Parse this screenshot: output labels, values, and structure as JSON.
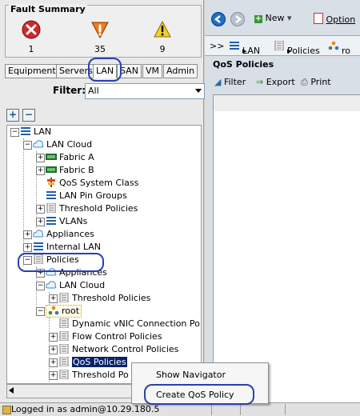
{
  "fault_summary": {
    "title": "Fault Summary",
    "counts": {
      "critical": "1",
      "major": "35",
      "minor": "9"
    }
  },
  "nav_tabs": [
    "Equipment",
    "Servers",
    "LAN",
    "SAN",
    "VM",
    "Admin"
  ],
  "filter": {
    "label": "Filter:",
    "value": "All"
  },
  "tree": {
    "items": [
      {
        "label": "LAN",
        "level": 0
      },
      {
        "label": "LAN Cloud",
        "level": 1
      },
      {
        "label": "Fabric A",
        "level": 2
      },
      {
        "label": "Fabric B",
        "level": 2
      },
      {
        "label": "QoS System Class",
        "level": 2
      },
      {
        "label": "LAN Pin Groups",
        "level": 2
      },
      {
        "label": "Threshold Policies",
        "level": 2
      },
      {
        "label": "VLANs",
        "level": 2
      },
      {
        "label": "Appliances",
        "level": 1
      },
      {
        "label": "Internal LAN",
        "level": 1
      },
      {
        "label": "Policies",
        "level": 1
      },
      {
        "label": "Appliances",
        "level": 2
      },
      {
        "label": "LAN Cloud",
        "level": 2
      },
      {
        "label": "Threshold Policies",
        "level": 3
      },
      {
        "label": "root",
        "level": 2
      },
      {
        "label": "Dynamic vNIC Connection Po",
        "level": 3
      },
      {
        "label": "Flow Control Policies",
        "level": 3
      },
      {
        "label": "Network Control Policies",
        "level": 3
      },
      {
        "label": "QoS Policies",
        "level": 3
      },
      {
        "label": "Threshold Po",
        "level": 3
      }
    ]
  },
  "status_bar": {
    "text": "Logged in as admin@10.29.180.5"
  },
  "toolbar": {
    "new_label": "New",
    "options_label": "Option"
  },
  "breadcrumb": {
    "prefix": ">>",
    "items": [
      "LAN",
      "Policies",
      "ro"
    ]
  },
  "qos_panel": {
    "title": "QoS Policies",
    "filter_label": "Filter",
    "export_label": "Export",
    "print_label": "Print"
  },
  "context_menu": {
    "items": [
      "Show Navigator",
      "Create QoS Policy"
    ]
  },
  "colors": {
    "accent": "#2a3faf",
    "selection": "#0a246a",
    "pane_bg": "#e9e9e9",
    "right_bg": "#d9dfe7"
  },
  "icons": [
    "critical-fault-icon",
    "major-fault-icon",
    "minor-fault-icon",
    "back-icon",
    "forward-icon",
    "new-icon",
    "options-icon",
    "lan-icon",
    "cloud-icon",
    "fabric-icon",
    "qos-icon",
    "pin-icon",
    "policy-icon",
    "vlan-icon",
    "root-org-icon",
    "filter-icon",
    "export-icon",
    "print-icon",
    "lock-icon"
  ]
}
